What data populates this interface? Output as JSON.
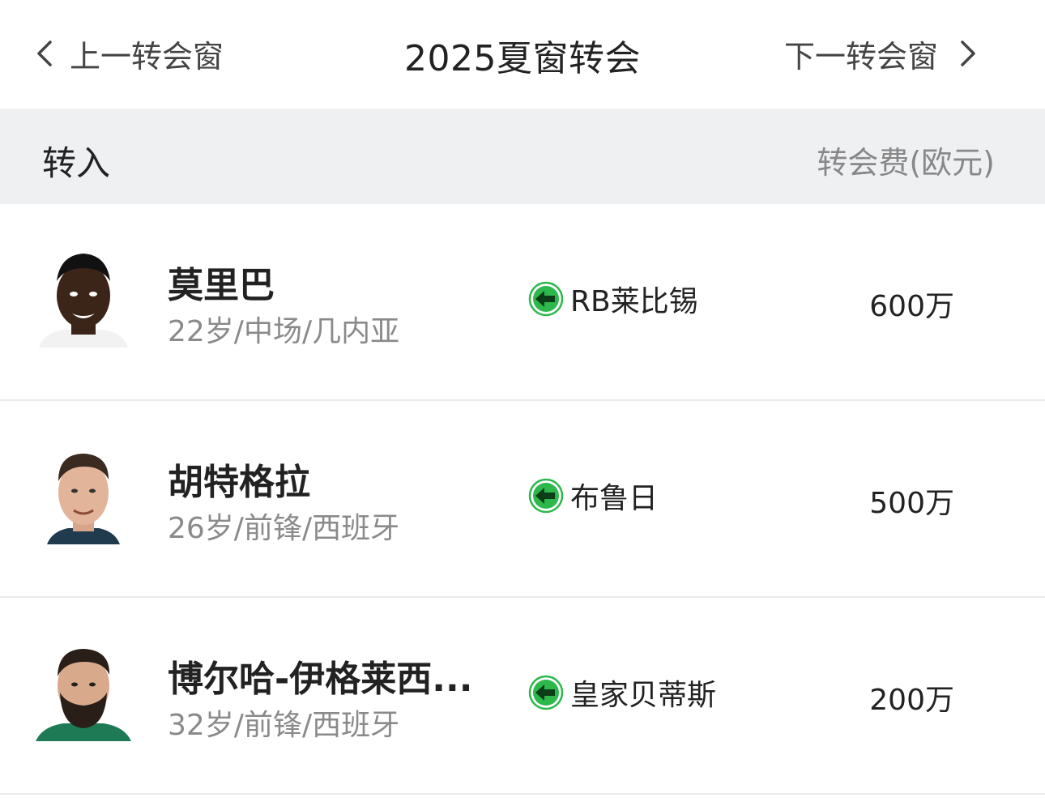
{
  "nav": {
    "prev_label": "上一转会窗",
    "title": "2025夏窗转会",
    "next_label": "下一转会窗"
  },
  "section": {
    "label": "转入",
    "fee_header": "转会费(欧元)"
  },
  "transfers": [
    {
      "name": "莫里巴",
      "meta": "22岁/中场/几内亚",
      "from_club": "RB莱比锡",
      "fee": "600万"
    },
    {
      "name": "胡特格拉",
      "meta": "26岁/前锋/西班牙",
      "from_club": "布鲁日",
      "fee": "500万"
    },
    {
      "name": "博尔哈-伊格莱西...",
      "meta": "32岁/前锋/西班牙",
      "from_club": "皇家贝蒂斯",
      "fee": "200万"
    }
  ],
  "colors": {
    "arrow_badge": "#2db84c",
    "section_bg": "#eff0f2",
    "secondary_text": "#8a8a8a"
  },
  "icons": {
    "prev": "chevron-left-icon",
    "next": "chevron-right-icon",
    "transfer_in": "arrow-left-circle-icon"
  }
}
